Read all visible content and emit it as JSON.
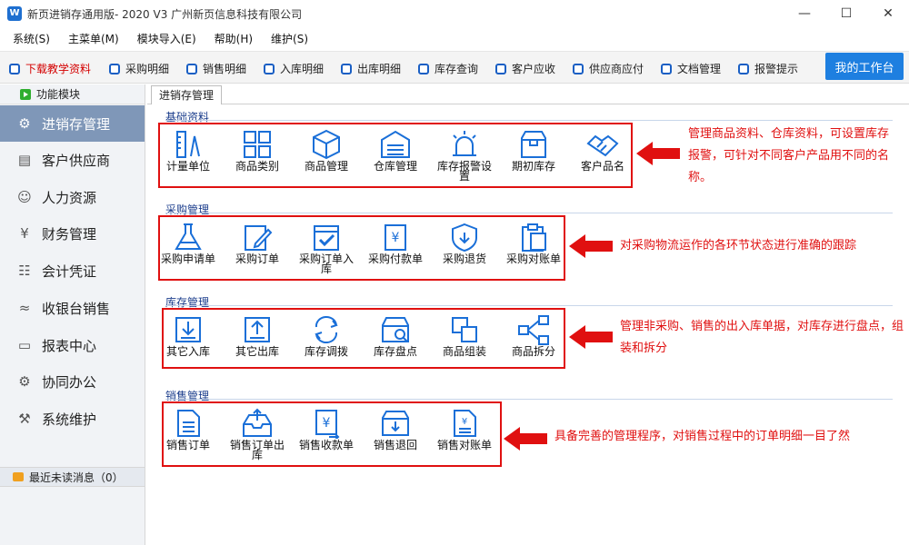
{
  "window": {
    "title": "新页进销存通用版- 2020 V3 广州新页信息科技有限公司"
  },
  "menu": [
    "系统(S)",
    "主菜单(M)",
    "模块导入(E)",
    "帮助(H)",
    "维护(S)"
  ],
  "quick": [
    "下载教学资料",
    "采购明细",
    "销售明细",
    "入库明细",
    "出库明细",
    "库存查询",
    "客户应收",
    "供应商应付",
    "文档管理",
    "报警提示"
  ],
  "workbench_label": "我的工作台",
  "sidebar": {
    "header": "功能模块",
    "items": [
      "进销存管理",
      "客户供应商",
      "人力资源",
      "财务管理",
      "会计凭证",
      "收银台销售",
      "报表中心",
      "协同办公",
      "系统维护"
    ],
    "footer": "最近未读消息（0）"
  },
  "tab": "进销存管理",
  "sections": {
    "basic": {
      "title": "基础资料",
      "items": [
        "计量单位",
        "商品类别",
        "商品管理",
        "仓库管理",
        "库存报警设置",
        "期初库存",
        "客户品名"
      ],
      "note": "管理商品资料、仓库资料，可设置库存报警，可针对不同客户产品用不同的名称。"
    },
    "purchase": {
      "title": "采购管理",
      "items": [
        "采购申请单",
        "采购订单",
        "采购订单入库",
        "采购付款单",
        "采购退货",
        "采购对账单"
      ],
      "note": "对采购物流运作的各环节状态进行准确的跟踪"
    },
    "stock": {
      "title": "库存管理",
      "items": [
        "其它入库",
        "其它出库",
        "库存调拨",
        "库存盘点",
        "商品组装",
        "商品拆分"
      ],
      "note": "管理非采购、销售的出入库单据，对库存进行盘点，组装和拆分"
    },
    "sales": {
      "title": "销售管理",
      "items": [
        "销售订单",
        "销售订单出库",
        "销售收款单",
        "销售退回",
        "销售对账单"
      ],
      "note": "具备完善的管理程序，对销售过程中的订单明细一目了然"
    }
  },
  "colors": {
    "accent": "#1e7fe0",
    "icon": "#1a6fd8",
    "annotation": "#e01010",
    "sidebar_active": "#7f97b8"
  }
}
